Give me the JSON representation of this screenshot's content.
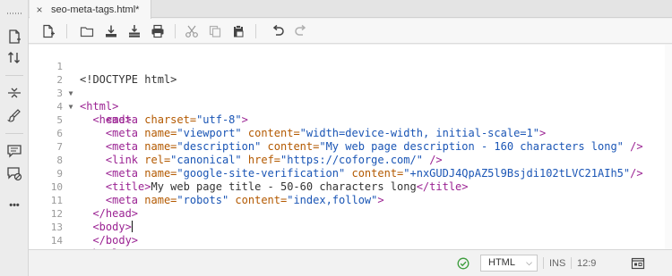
{
  "tab": {
    "title": "seo-meta-tags.html*",
    "close_glyph": "×"
  },
  "toolbar": {
    "buttons": [
      "new-file-icon",
      "open-folder-icon",
      "save-icon",
      "save-all-icon",
      "print-icon",
      "cut-icon",
      "copy-icon",
      "paste-icon",
      "undo-icon",
      "redo-icon"
    ]
  },
  "activity_bar": {
    "items": [
      "new-document-icon",
      "sort-icon",
      "collapse-icon",
      "brush-icon",
      "comment-icon",
      "comment-disable-icon",
      "more-icon"
    ],
    "more_glyph": "•••"
  },
  "editor": {
    "line_numbers": [
      "1",
      "2",
      "3",
      "4",
      "5",
      "6",
      "7",
      "8",
      "9",
      "10",
      "11",
      "12",
      "13",
      "14"
    ],
    "fold_markers": {
      "2": "▼",
      "3": "▼"
    },
    "cursor_line": 12
  },
  "status": {
    "language": "HTML",
    "mode": "INS",
    "position": "12:9",
    "ok_color": "#3c9c3c"
  },
  "colors": {
    "tag": "#9b2393",
    "attribute": "#b35900",
    "string": "#1a55b5"
  }
}
